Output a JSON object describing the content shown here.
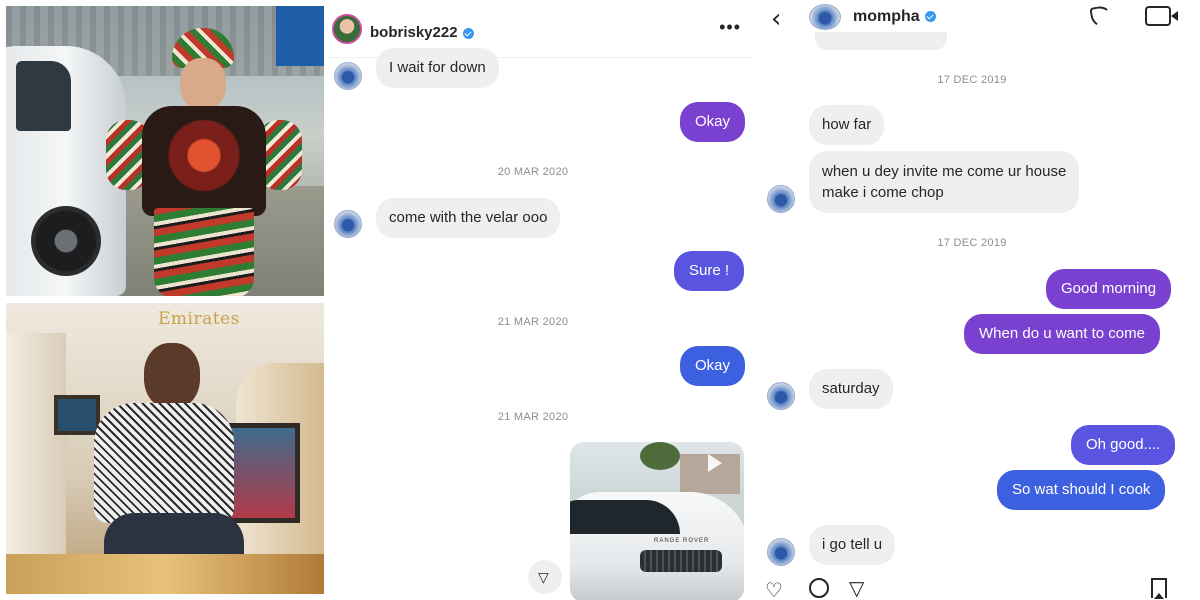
{
  "photos": {
    "bottom_brand": "Emirates"
  },
  "chat_a": {
    "username": "bobrisky222",
    "more_label": "•••",
    "messages": [
      {
        "side": "in",
        "text": "I wait for down"
      },
      {
        "side": "out",
        "text": "Okay"
      },
      {
        "side": "date",
        "text": "20 MAR 2020"
      },
      {
        "side": "in",
        "text": "come with the velar ooo"
      },
      {
        "side": "out",
        "text": "Sure !"
      },
      {
        "side": "date",
        "text": "21 MAR 2020"
      },
      {
        "side": "out",
        "text": "Okay"
      },
      {
        "side": "date",
        "text": "21 MAR 2020"
      }
    ],
    "media_badge": "RANGE ROVER",
    "send_glyph": "▽"
  },
  "chat_b": {
    "username": "mompha",
    "back_glyph": "‹",
    "messages": [
      {
        "side": "date",
        "text": "17 DEC 2019"
      },
      {
        "side": "in",
        "text": "how far"
      },
      {
        "side": "in",
        "text": "when u dey invite me come ur house\nmake i come chop"
      },
      {
        "side": "date",
        "text": "17 DEC 2019"
      },
      {
        "side": "out",
        "text": "Good morning"
      },
      {
        "side": "out",
        "text": "When do u want to come"
      },
      {
        "side": "in",
        "text": "saturday"
      },
      {
        "side": "out",
        "text": "Oh good...."
      },
      {
        "side": "out",
        "text": "So wat should I cook"
      },
      {
        "side": "in",
        "text": "i go tell u"
      }
    ],
    "actions": {
      "heart_glyph": "♡",
      "share_glyph": "▽"
    }
  },
  "colors": {
    "bubble_purple": "#7a41d1",
    "bubble_indigo": "#5a55e1",
    "bubble_blue": "#3d60e0",
    "bubble_gray": "#efefef",
    "verified_blue": "#3897f0"
  }
}
